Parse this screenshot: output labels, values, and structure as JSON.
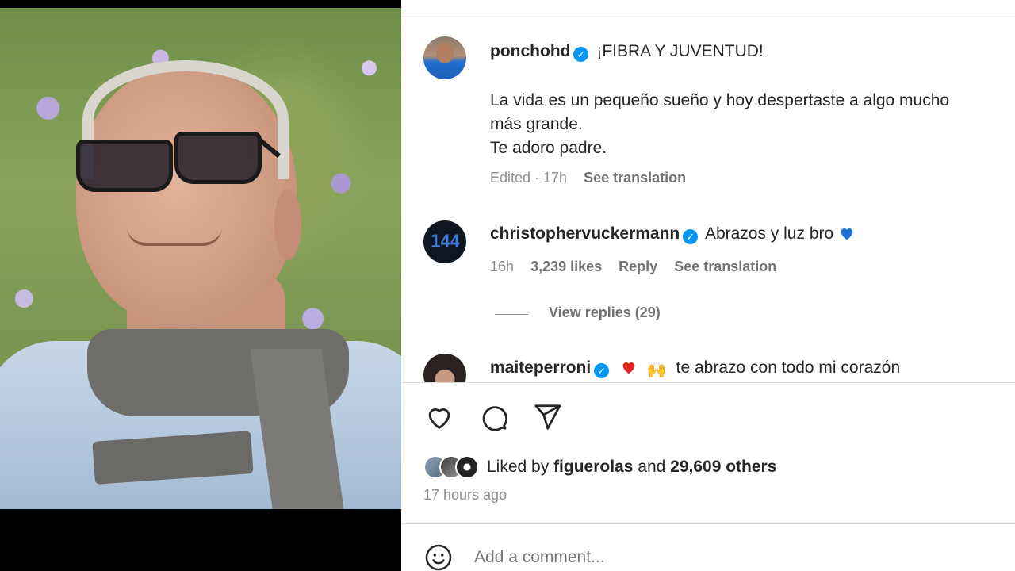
{
  "post": {
    "author": {
      "username": "ponchohd",
      "verified": true
    },
    "caption": {
      "line1": "¡FIBRA Y JUVENTUD!",
      "line2": "La vida es un pequeño sueño y hoy despertaste a algo mucho",
      "line3": "más grande.",
      "line4": "Te adoro padre."
    },
    "meta": {
      "edited": "Edited · 17h",
      "see_translation": "See translation"
    }
  },
  "comments": [
    {
      "username": "christophervuckermann",
      "verified": true,
      "text": "Abrazos y luz bro",
      "avatar_text": "144",
      "time": "16h",
      "likes": "3,239 likes",
      "reply_label": "Reply",
      "see_translation": "See translation",
      "view_replies": "View replies (29)"
    },
    {
      "username": "maiteperroni",
      "verified": true,
      "text": "te abrazo con todo mi corazón"
    }
  ],
  "likes": {
    "prefix": "Liked by",
    "user": "figuerolas",
    "and": "and",
    "others": "29,609 others"
  },
  "time_ago": "17 hours ago",
  "comment_box": {
    "placeholder": "Add a comment..."
  },
  "icons": {
    "like": "heart-outline-icon",
    "comment": "speech-bubble-icon",
    "share": "paper-plane-icon",
    "emoji": "smiley-icon",
    "verified": "verified-badge-icon"
  },
  "colors": {
    "verified": "#0095f6",
    "text": "#262626",
    "muted": "#8e8e8e",
    "divider": "#dbdbdb"
  }
}
